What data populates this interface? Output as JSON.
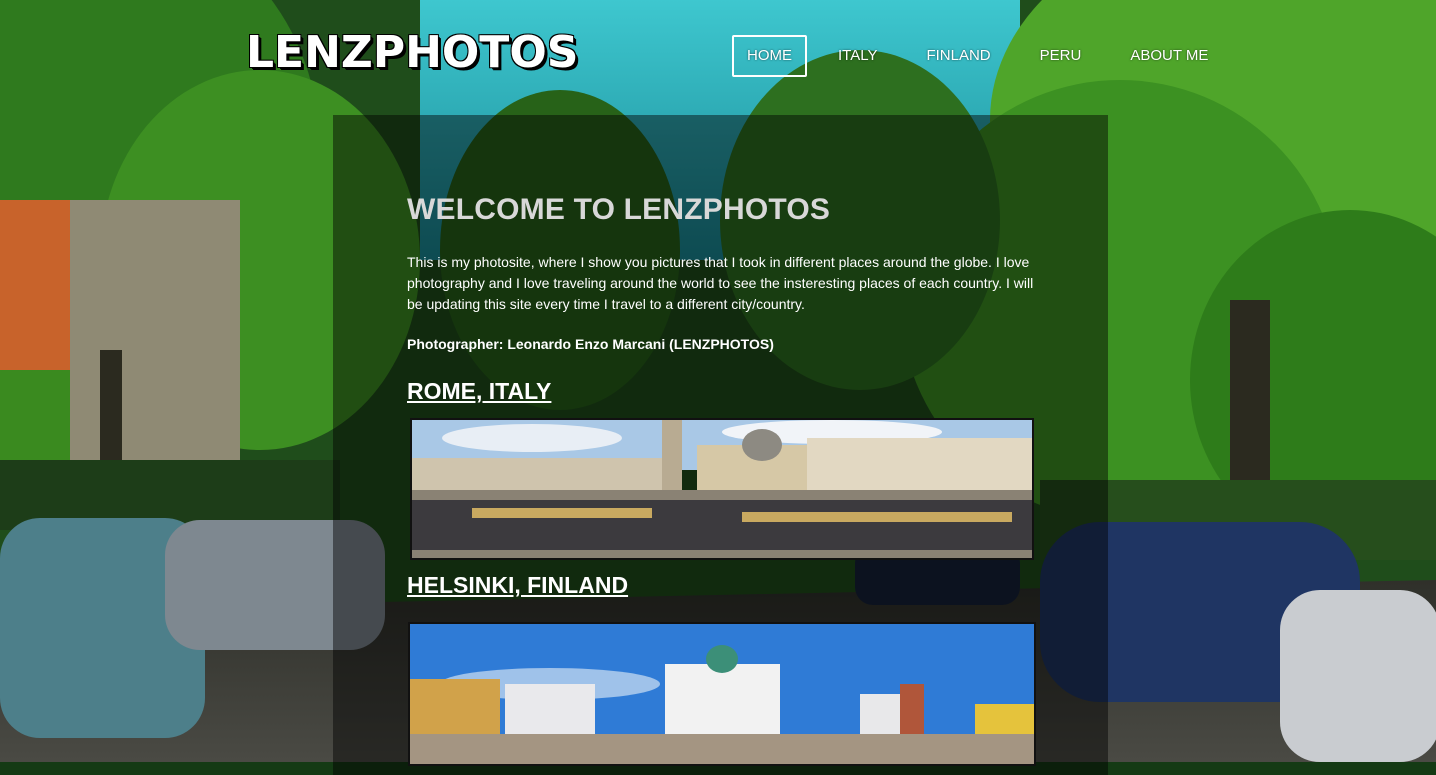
{
  "site": {
    "logo_text": "LENZPHOTOS"
  },
  "nav": {
    "items": [
      {
        "label": "HOME",
        "active": true
      },
      {
        "label": "ITALY",
        "active": false
      },
      {
        "label": "FINLAND",
        "active": false
      },
      {
        "label": "PERU",
        "active": false
      },
      {
        "label": "ABOUT ME",
        "active": false
      }
    ]
  },
  "main": {
    "title": "WELCOME TO LENZPHOTOS",
    "intro": "This is my photosite, where I show you pictures that I took in different places around the globe. I love photography and I love traveling around the world to see the insteresting places of each country. I will be updating this site every time I travel to a different city/country.",
    "credit": "Photographer: Leonardo Enzo Marcani (LENZPHOTOS)",
    "sections": [
      {
        "title": "ROME, ITALY"
      },
      {
        "title": "HELSINKI, FINLAND"
      }
    ]
  },
  "colors": {
    "panel_overlay": "rgba(0,0,0,0.45)",
    "title_gray": "#d8d8d8",
    "text_white": "#ffffff"
  }
}
